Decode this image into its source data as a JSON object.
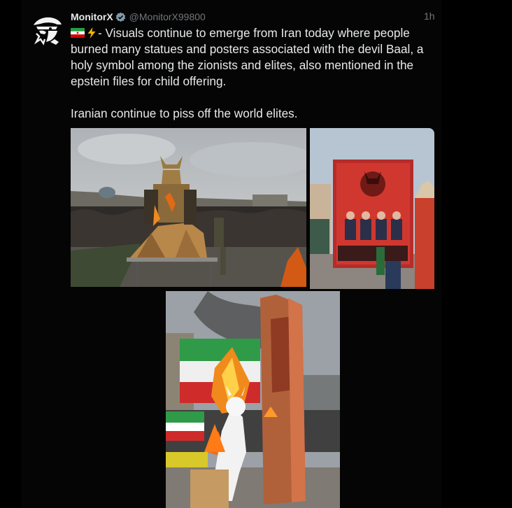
{
  "tweet": {
    "display_name": "MonitorX",
    "handle": "@MonitorX99800",
    "time": "1h",
    "emoji": [
      "iran-flag",
      "lightning-bolt"
    ],
    "text_line1": "- Visuals continue to emerge from Iran today where people burned many statues and posters associated with the devil Baal, a holy symbol among the zionists and elites, also mentioned in the epstein files for child offering.",
    "text_line2": "Iranian continue to piss off the world elites."
  },
  "colors": {
    "background": "#000000",
    "text": "#e7e9ea",
    "muted": "#71767b",
    "verified": "#829aab"
  }
}
